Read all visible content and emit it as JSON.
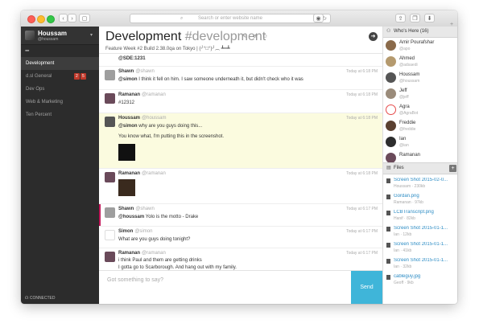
{
  "browser": {
    "address_placeholder": "Search or enter website name",
    "back": "‹",
    "forward": "›",
    "sidebar_toggle": "▢",
    "reload": "↻",
    "share": "⇪",
    "tabs": "❐",
    "download": "⬇",
    "new_tab": "+"
  },
  "sidebar": {
    "user": {
      "name": "Houssam",
      "handle": "@houssam",
      "caret": "▾"
    },
    "grid_icon": "▪▪▪",
    "channels": [
      {
        "label": "Development",
        "active": true
      },
      {
        "label": "d.sl General",
        "badge_a": "2",
        "badge_b": "5"
      },
      {
        "label": "Dev Ops"
      },
      {
        "label": "Web & Marketing"
      },
      {
        "label": "Ten Percent"
      }
    ],
    "status": "☊ CONNECTED"
  },
  "channel": {
    "name": "Development",
    "hash_name": "#development",
    "topic": "Feature Week #2 Build 2.38.0qa on Tokyo | (╯°□°)╯︵ ┻━┻",
    "icons": "✎ ↺ ⚇",
    "go_icon": "➜"
  },
  "messages": [
    {
      "text": "@SDE:1231"
    },
    {
      "name": "Shawn",
      "handle": "@shawn",
      "time": "Today at 6:18 PM",
      "mention": "@simon",
      "text": " I think it fell on him. I saw someone underneath it, but didn't check who it was"
    },
    {
      "name": "Ramanan",
      "handle": "@ramanan",
      "time": "Today at 6:18 PM",
      "text": "#12312"
    },
    {
      "name": "Houssam",
      "handle": "@houssam",
      "time": "Today at 6:18 PM",
      "mention": "@simon",
      "text": " why are you guys doing this...",
      "text2": "You know what, I'm putting this in the screenshot."
    },
    {
      "name": "Ramanan",
      "handle": "@ramanan",
      "time": "Today at 6:18 PM"
    },
    {
      "name": "Shawn",
      "handle": "@shawn",
      "time": "Today at 6:17 PM",
      "mention": "@houssam",
      "text": " Yolo is the motto - Drake"
    },
    {
      "name": "Simon",
      "handle": "@simon",
      "time": "Today at 6:17 PM",
      "text": "What are you guys doing tonight?"
    },
    {
      "name": "Ramanan",
      "handle": "@ramanan",
      "time": "Today at 6:17 PM",
      "text": "i think Paul and them are getting drinks",
      "text2": "I gotta go to Scarborough. And hang out with my family."
    }
  ],
  "composer": {
    "placeholder": "Got something to say?",
    "send": "Send"
  },
  "who": {
    "title": "Who's Here (16)",
    "icon": "⚇",
    "users": [
      {
        "name": "Amir Pourafshar",
        "handle": "@apo",
        "color": "#8a6a4a"
      },
      {
        "name": "Ahmed",
        "handle": "@adsaedi",
        "color": "#b59a6e"
      },
      {
        "name": "Houssam",
        "handle": "@houssam",
        "color": "#555555"
      },
      {
        "name": "Jeff",
        "handle": "@jeff",
        "color": "#9a8b7a"
      },
      {
        "name": "Agra",
        "handle": "@AgraBot",
        "color": "#e64a4a"
      },
      {
        "name": "Freddie",
        "handle": "@freddie",
        "color": "#5a4030"
      },
      {
        "name": "Ian",
        "handle": "@ian",
        "color": "#2d2d2d"
      },
      {
        "name": "Ramanan",
        "handle": "",
        "color": "#6a4a5a"
      }
    ]
  },
  "files": {
    "title": "Files",
    "icon": "▤",
    "add": "+",
    "items": [
      {
        "name": "Screen Shot 2015-02-0...",
        "meta": "Houssam · 230kb"
      },
      {
        "name": "Gordan.png",
        "meta": "Ramanan · 97kb"
      },
      {
        "name": "LCBTranscript.png",
        "meta": "Hanif · 82kb"
      },
      {
        "name": "Screen Shot 2015-01-1...",
        "meta": "Ian · 12kb"
      },
      {
        "name": "Screen Shot 2015-01-1...",
        "meta": "Ian · 41kb"
      },
      {
        "name": "Screen Shot 2015-01-1...",
        "meta": "Ian · 32kb"
      },
      {
        "name": "cableguy.jpg",
        "meta": "Geoff · 9kb"
      }
    ]
  },
  "colors": {
    "send": "#3fb5d9",
    "highlight": "#fbfbdf",
    "sidebar": "#2c2c2c",
    "link": "#2a8bc4"
  }
}
